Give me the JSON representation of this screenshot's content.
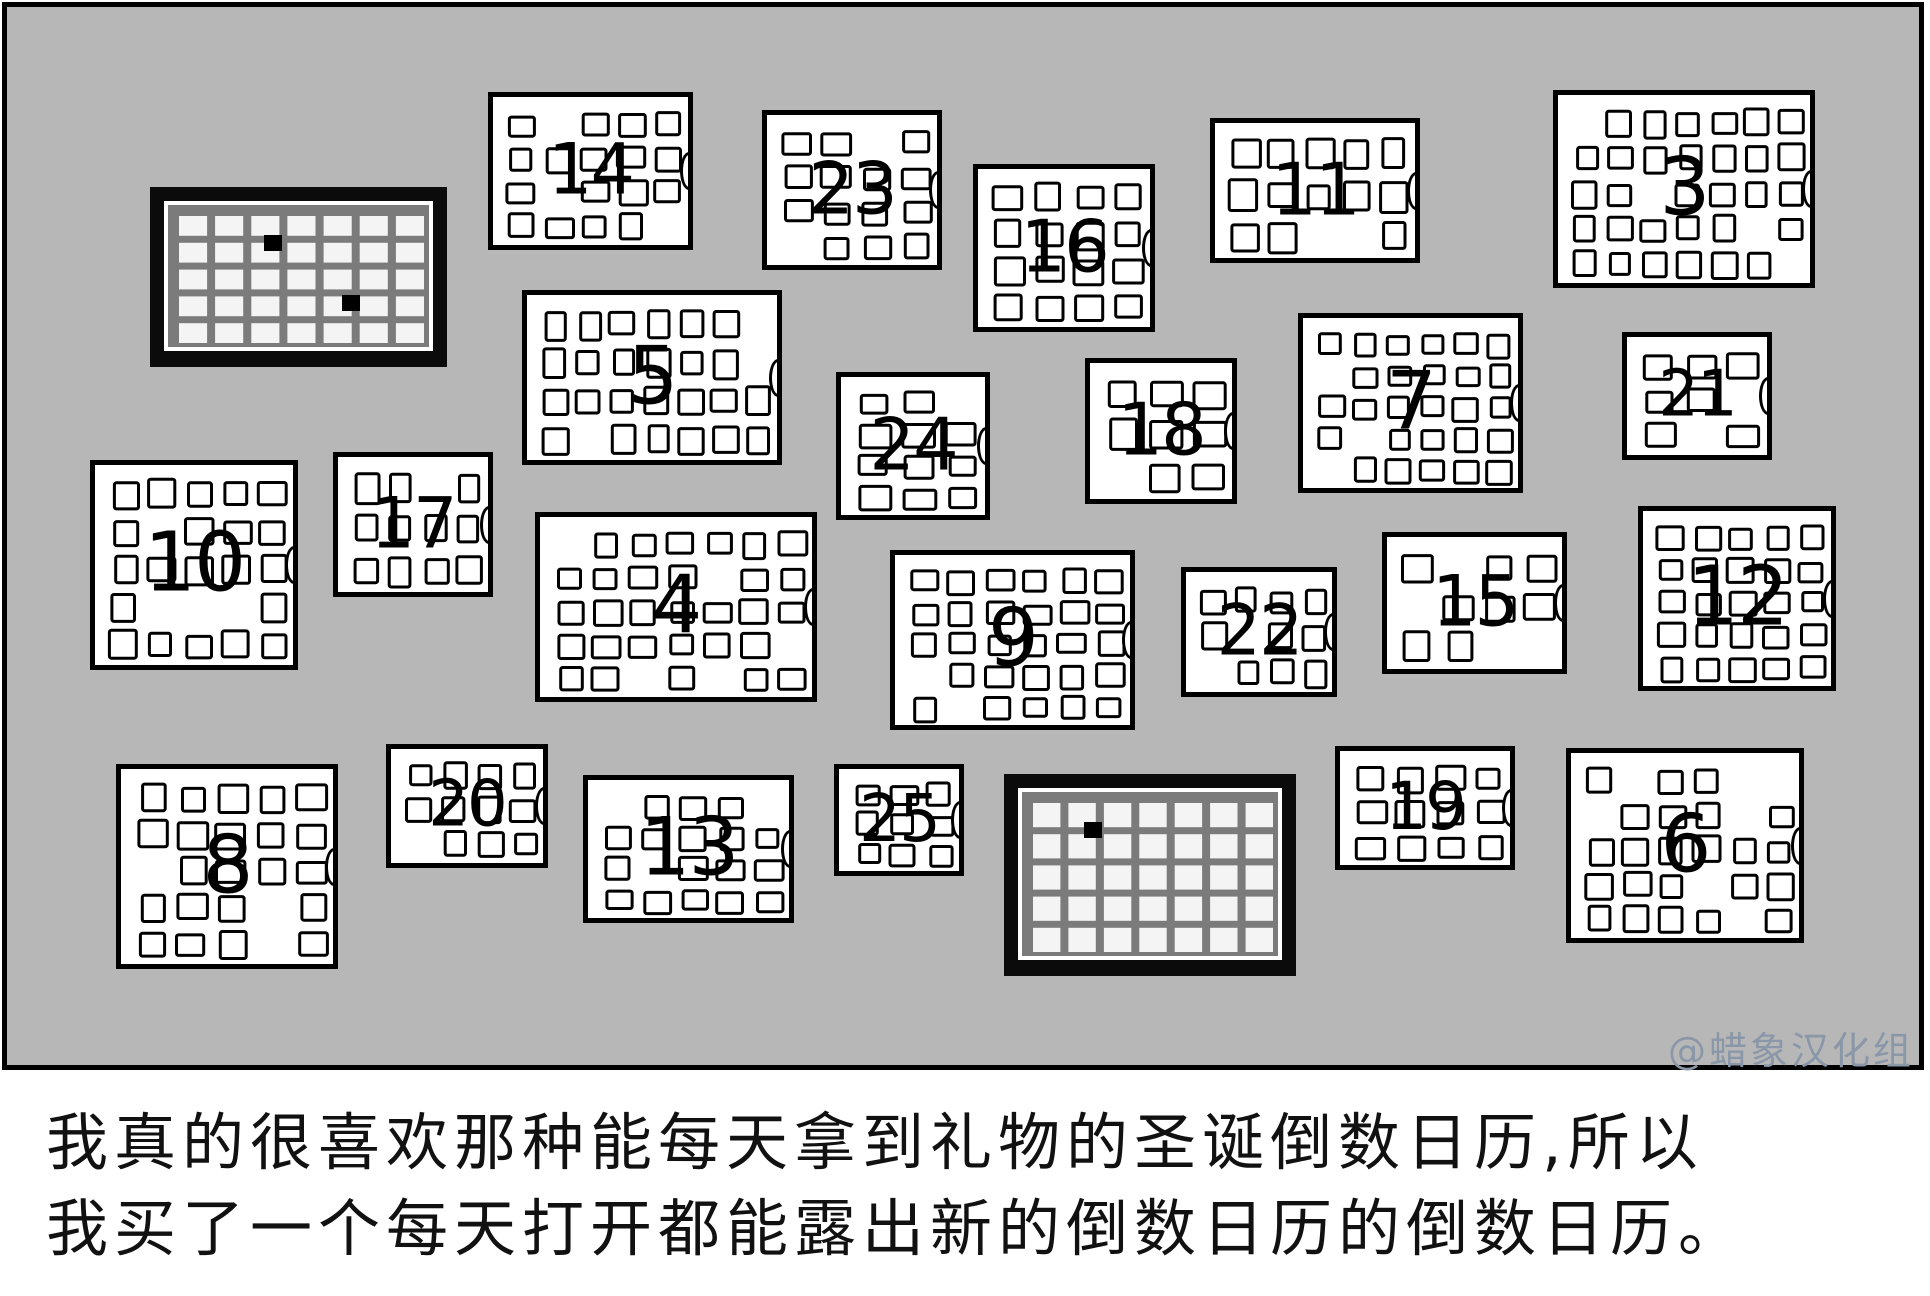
{
  "calendars": [
    {
      "number": "14"
    },
    {
      "number": "23"
    },
    {
      "number": "16"
    },
    {
      "number": "11"
    },
    {
      "number": "3"
    },
    {
      "number": "5"
    },
    {
      "number": "24"
    },
    {
      "number": "18"
    },
    {
      "number": "7"
    },
    {
      "number": "21"
    },
    {
      "number": "10"
    },
    {
      "number": "17"
    },
    {
      "number": "4"
    },
    {
      "number": "9"
    },
    {
      "number": "22"
    },
    {
      "number": "15"
    },
    {
      "number": "12"
    },
    {
      "number": "8"
    },
    {
      "number": "20"
    },
    {
      "number": "13"
    },
    {
      "number": "25"
    },
    {
      "number": "19"
    },
    {
      "number": "6"
    }
  ],
  "watermark": "@蜡象汉化组",
  "caption": {
    "line1": "我真的很喜欢那种能每天拿到礼物的圣诞倒数日历,所以",
    "line2": "我买了一个每天打开都能露出新的倒数日历的倒数日历。"
  },
  "colors": {
    "background": "#b7b7b7",
    "opened_calendar": "#7b7b7b",
    "watermark": "#8a97a8"
  }
}
